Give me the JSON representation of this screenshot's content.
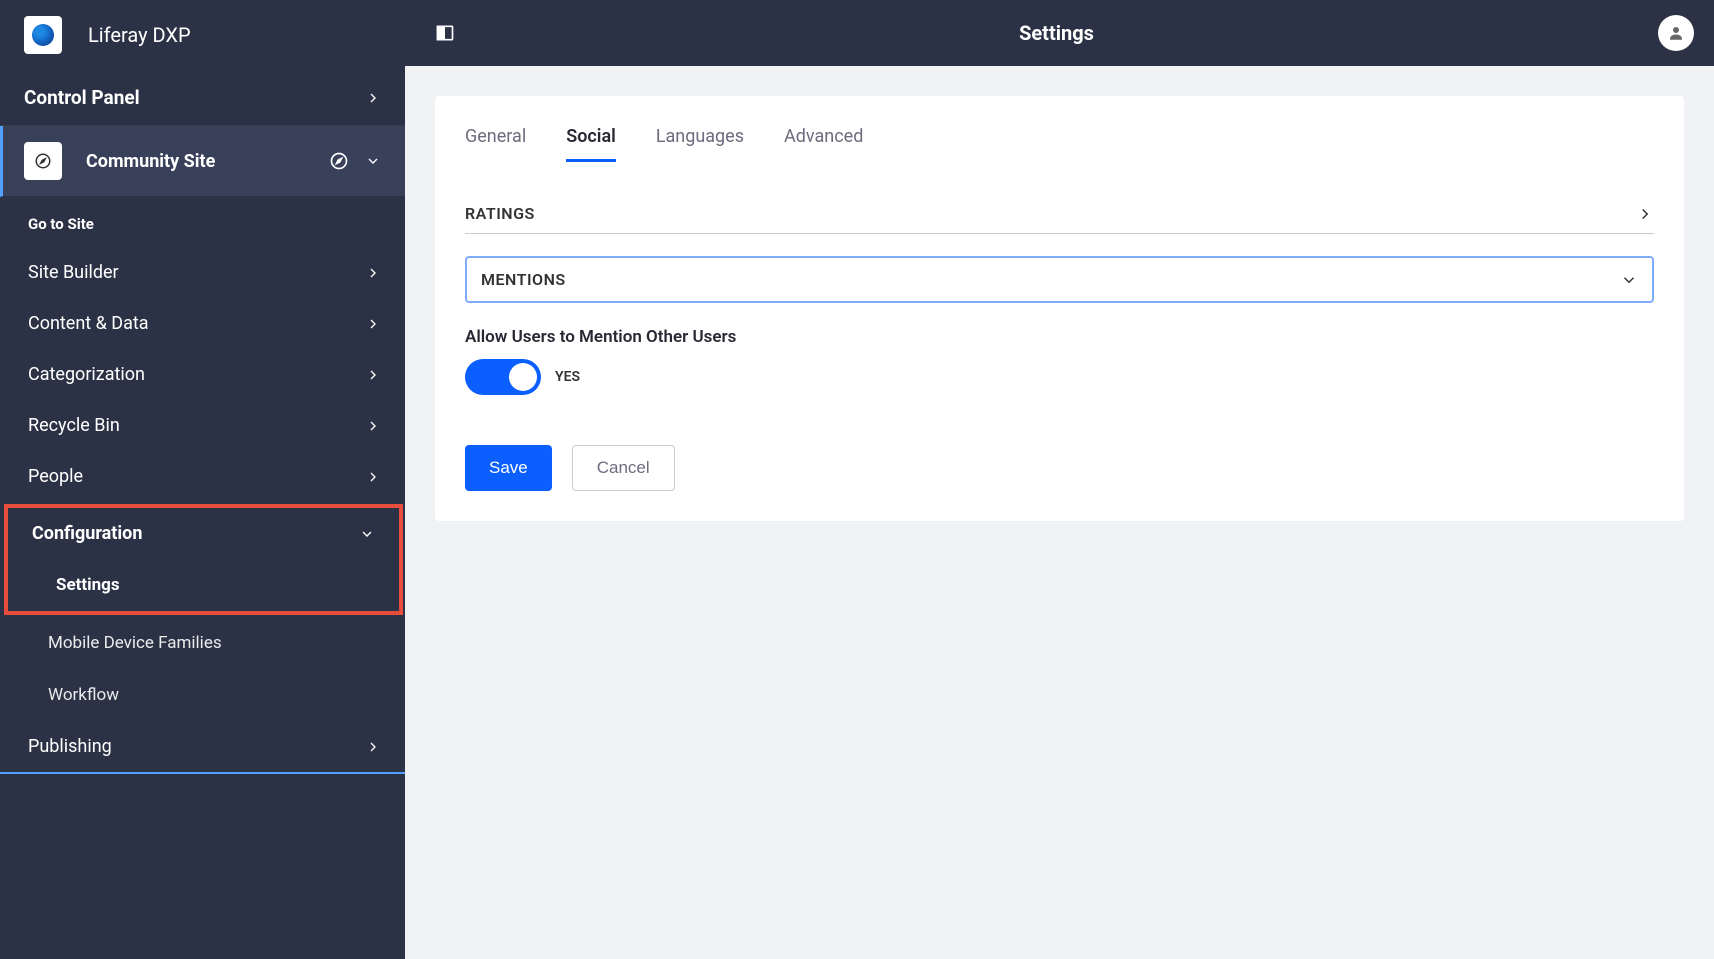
{
  "brand": {
    "title": "Liferay DXP"
  },
  "sidebar": {
    "control_panel": "Control Panel",
    "site_name": "Community Site",
    "go_to_site": "Go to Site",
    "items": [
      {
        "label": "Site Builder"
      },
      {
        "label": "Content & Data"
      },
      {
        "label": "Categorization"
      },
      {
        "label": "Recycle Bin"
      },
      {
        "label": "People"
      },
      {
        "label": "Configuration"
      },
      {
        "label": "Publishing"
      }
    ],
    "config_subitems": [
      {
        "label": "Settings"
      },
      {
        "label": "Mobile Device Families"
      },
      {
        "label": "Workflow"
      }
    ]
  },
  "topbar": {
    "title": "Settings"
  },
  "tabs": [
    {
      "label": "General"
    },
    {
      "label": "Social"
    },
    {
      "label": "Languages"
    },
    {
      "label": "Advanced"
    }
  ],
  "sections": {
    "ratings": {
      "title": "RATINGS"
    },
    "mentions": {
      "title": "MENTIONS",
      "setting_label": "Allow Users to Mention Other Users",
      "toggle_value": "YES"
    }
  },
  "buttons": {
    "save": "Save",
    "cancel": "Cancel"
  }
}
